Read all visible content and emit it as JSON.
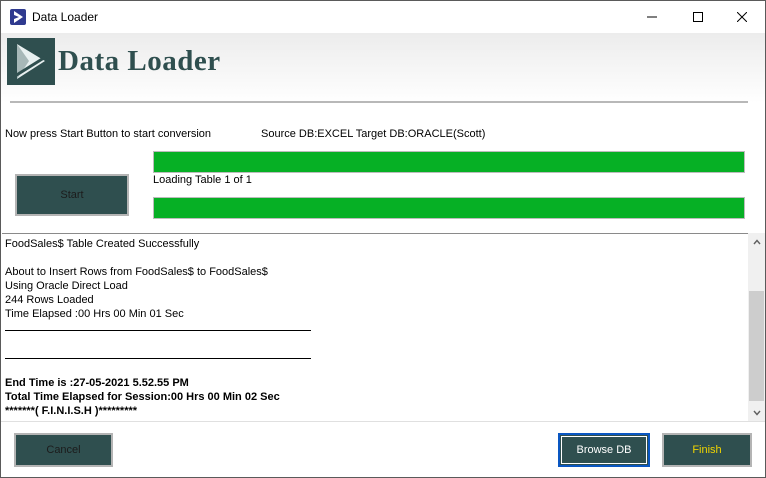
{
  "window": {
    "title": "Data Loader"
  },
  "header": {
    "title": "Data Loader"
  },
  "status": {
    "instruction": "Now press Start Button to start conversion",
    "source_target": "Source DB:EXCEL Target DB:ORACLE(Scott)"
  },
  "progress": {
    "overall_fraction": 1.0,
    "table_fraction": 1.0,
    "label": "Loading Table 1 of 1"
  },
  "buttons": {
    "start": "Start",
    "cancel": "Cancel",
    "browse_db": "Browse DB",
    "finish": "Finish"
  },
  "log": {
    "lines": [
      "FoodSales$ Table Created Successfully",
      "About to Insert Rows from FoodSales$ to FoodSales$",
      "Using Oracle Direct Load",
      "244 Rows Loaded",
      "Time Elapsed :00 Hrs 00 Min 01 Sec",
      "End Time is :27-05-2021 5.52.55 PM",
      "Total Time Elapsed for Session:00 Hrs 00 Min 02 Sec",
      "*******( F.I.N.I.S.H )*********"
    ]
  },
  "colors": {
    "accent": "#2f4f4f",
    "progress": "#06b025",
    "finish_text": "#f0d400",
    "focus_border": "#0a57c2"
  },
  "icons": {
    "app": "play-logo-icon",
    "minimize": "minimize-icon",
    "maximize": "maximize-icon",
    "close": "close-icon",
    "scroll_up": "chevron-up-icon",
    "scroll_down": "chevron-down-icon"
  }
}
